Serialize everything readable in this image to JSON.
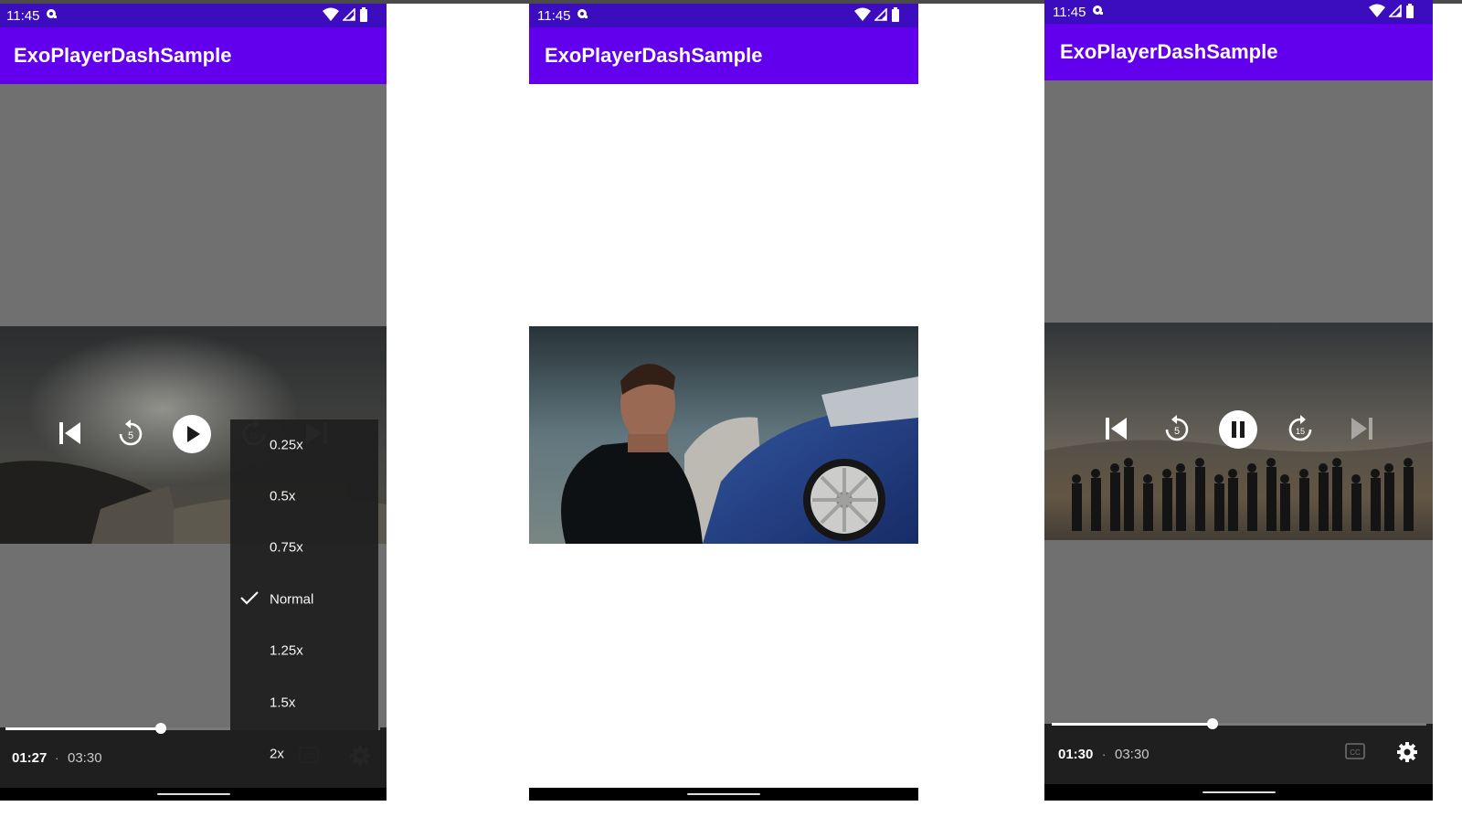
{
  "app_title": "ExoPlayerDashSample",
  "status_time": "11:45",
  "colors": {
    "app_bar": "#6200ee",
    "status_bar": "#3c0dbf",
    "player_bg": "#707070",
    "controls_bar": "#1f1f1f"
  },
  "screens": [
    {
      "state": "paused",
      "current_time": "01:27",
      "separator": "·",
      "duration": "03:30",
      "progress": 0.4142,
      "controls": [
        "previous-icon",
        "replay-5-icon",
        "play-icon",
        "forward-15-icon",
        "next-icon"
      ],
      "speed_menu": {
        "options": [
          "0.25x",
          "0.5x",
          "0.75x",
          "Normal",
          "1.25x",
          "1.5x",
          "2x"
        ],
        "selected": "Normal"
      }
    },
    {
      "state": "video-only"
    },
    {
      "state": "playing",
      "current_time": "01:30",
      "separator": "·",
      "duration": "03:30",
      "progress": 0.4286,
      "controls": [
        "previous-icon",
        "replay-5-icon",
        "pause-icon",
        "forward-15-icon",
        "next-icon"
      ]
    }
  ]
}
